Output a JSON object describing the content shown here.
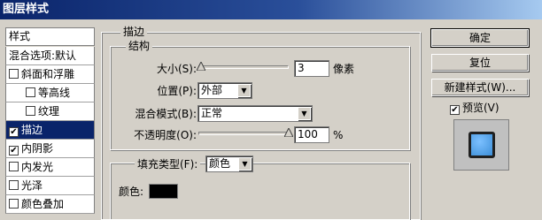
{
  "window": {
    "title": "图层样式"
  },
  "sidebar": {
    "header": "样式",
    "items": [
      {
        "label": "混合选项:默认",
        "checkbox": false,
        "checked": false,
        "indent": false,
        "selected": false
      },
      {
        "label": "斜面和浮雕",
        "checkbox": true,
        "checked": false,
        "indent": false,
        "selected": false
      },
      {
        "label": "等高线",
        "checkbox": true,
        "checked": false,
        "indent": true,
        "selected": false
      },
      {
        "label": "纹理",
        "checkbox": true,
        "checked": false,
        "indent": true,
        "selected": false
      },
      {
        "label": "描边",
        "checkbox": true,
        "checked": true,
        "indent": false,
        "selected": true
      },
      {
        "label": "内阴影",
        "checkbox": true,
        "checked": true,
        "indent": false,
        "selected": false
      },
      {
        "label": "内发光",
        "checkbox": true,
        "checked": false,
        "indent": false,
        "selected": false
      },
      {
        "label": "光泽",
        "checkbox": true,
        "checked": false,
        "indent": false,
        "selected": false
      },
      {
        "label": "颜色叠加",
        "checkbox": true,
        "checked": false,
        "indent": false,
        "selected": false
      }
    ]
  },
  "stroke": {
    "section_title": "描边",
    "structure_title": "结构",
    "size_label": "大小(S):",
    "size_value": "3",
    "size_unit": "像素",
    "size_fraction": 0.03,
    "position_label": "位置(P):",
    "position_value": "外部",
    "blend_label": "混合模式(B):",
    "blend_value": "正常",
    "opacity_label": "不透明度(O):",
    "opacity_value": "100",
    "opacity_unit": "%",
    "opacity_fraction": 1.0,
    "fill_type_label": "填充类型(F):",
    "fill_type_value": "颜色",
    "color_label": "颜色:",
    "color_value": "#000000"
  },
  "buttons": {
    "ok": "确定",
    "reset": "复位",
    "new_style": "新建样式(W)...",
    "preview_label": "预览(V)",
    "preview_checked": true
  },
  "colors": {
    "titlebar_start": "#0a246a",
    "titlebar_end": "#a6caf0",
    "selection": "#0a246a",
    "preview_fill": "#3d8fd8"
  }
}
